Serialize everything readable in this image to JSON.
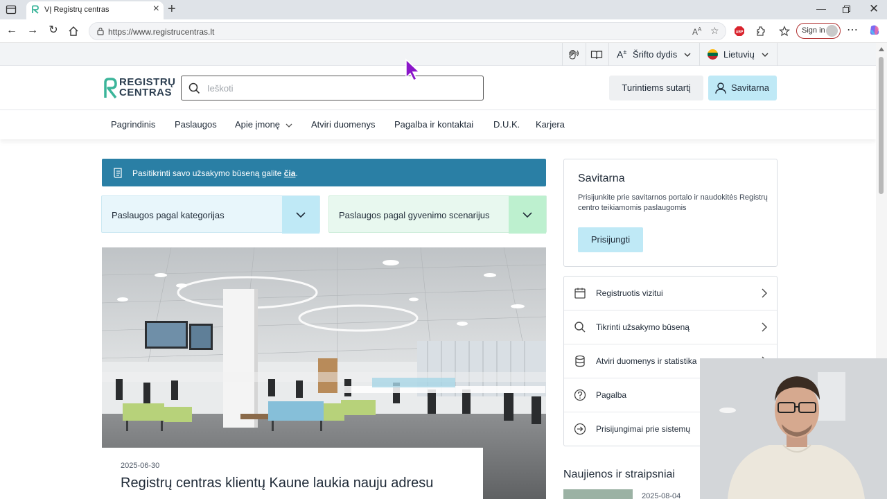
{
  "browser": {
    "tab_title": "VĮ Registrų centras",
    "url": "https://www.registrucentras.lt",
    "signin_label": "Sign in"
  },
  "utility": {
    "font_size_label": "Šrifto dydis",
    "language_label": "Lietuvių"
  },
  "header": {
    "logo_line1": "REGISTRŲ",
    "logo_line2": "CENTRAS",
    "search_placeholder": "Ieškoti",
    "business_button": "Turintiems sutartį",
    "savitarna_button": "Savitarna"
  },
  "nav": {
    "items": [
      "Pagrindinis",
      "Paslaugos",
      "Apie įmonę",
      "Atviri duomenys",
      "Pagalba ir kontaktai",
      "D.U.K.",
      "Karjera"
    ]
  },
  "notice": {
    "text": "Pasitikrinti savo užsakymo būseną galite ",
    "link": "čia",
    "end": "."
  },
  "dropdowns": {
    "categories": "Paslaugos pagal kategorijas",
    "scenarios": "Paslaugos pagal gyvenimo scenarijus"
  },
  "featured": {
    "date": "2025-06-30",
    "title": "Registrų centras klientų Kaune laukia nauju adresu"
  },
  "sidebar": {
    "savitarna_title": "Savitarna",
    "savitarna_desc": "Prisijunkite prie savitarnos portalo ir naudokitės Registrų centro teikiamomis paslaugomis",
    "login_button": "Prisijungti",
    "links": [
      {
        "label": "Registruotis vizitui",
        "icon": "calendar-icon"
      },
      {
        "label": "Tikrinti užsakymo būseną",
        "icon": "search-icon"
      },
      {
        "label": "Atviri duomenys ir statistika",
        "icon": "database-icon"
      },
      {
        "label": "Pagalba",
        "icon": "help-icon"
      },
      {
        "label": "Prisijungimai prie sistemų",
        "icon": "login-arrow-icon"
      }
    ],
    "news_heading": "Naujienos ir straipsniai",
    "news_first_date": "2025-08-04"
  },
  "colors": {
    "notice_bg": "#2a7fa5",
    "savitarna_accent": "#bfe9f6",
    "categories_bg": "#e8f6fb",
    "scenarios_bg": "#e8f8ef"
  }
}
